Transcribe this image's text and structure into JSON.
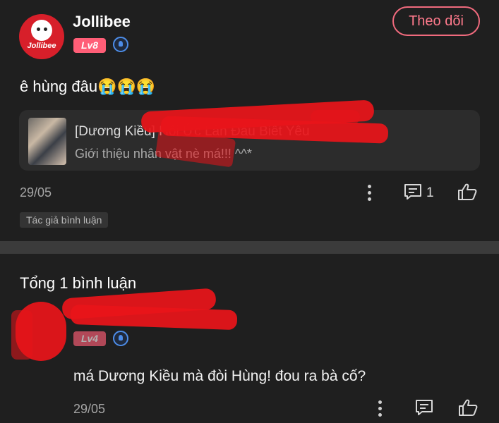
{
  "post": {
    "author": {
      "name": "Jollibee",
      "avatar_text": "Jollibee",
      "level": "Lv8",
      "badge_icon": "medal-icon"
    },
    "follow_label": "Theo dõi",
    "text": "ê hùng đâu😭😭😭",
    "linked_story": {
      "title": "[Dương Kiều] Hồi Ức Lần Đầu Biết Yêu",
      "subtitle": "Giới thiệu nhân vật nè má!!! ^^*"
    },
    "date": "29/05",
    "comment_count": "1",
    "author_tag": "Tác giả bình luận"
  },
  "comments_section": {
    "total_label": "Tổng 1 bình luận",
    "comments": [
      {
        "level": "Lv4",
        "text": "má Dương Kiều mà đòi Hùng! đou ra bà cố?",
        "date": "29/05"
      }
    ]
  },
  "colors": {
    "background": "#1f1f1f",
    "card": "#2c2c2c",
    "accent_pink": "#ff5e77",
    "follow_border": "#f06a7d",
    "redaction_red": "#e8141a",
    "badge_blue": "#4d8de8"
  },
  "icons": [
    "more-dots-icon",
    "comment-icon",
    "like-thumb-icon",
    "medal-icon"
  ]
}
